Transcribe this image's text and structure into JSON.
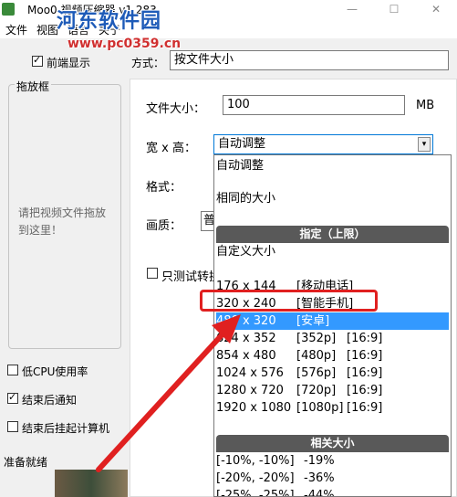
{
  "window": {
    "title": "Moo0 视频压缩器 v1.283",
    "minimize": "—",
    "maximize": "☐",
    "close": "✕"
  },
  "watermark": {
    "line1": "河东软件园",
    "line2": "www.pc0359.cn"
  },
  "menu": [
    "文件",
    "视图",
    "语言",
    "关于"
  ],
  "left": {
    "always_on_top": {
      "label": "前端显示",
      "checked": true
    },
    "drop_box_title": "拖放框",
    "drop_hint": "请把视频文件拖放到这里！",
    "low_cpu": {
      "label": "低CPU使用率",
      "checked": false
    },
    "notify_done": {
      "label": "结束后通知",
      "checked": true
    },
    "shutdown_done": {
      "label": "结束后挂起计算机",
      "checked": false
    },
    "status": "准备就绪"
  },
  "right": {
    "mode_label": "方式：",
    "mode_value": "按文件大小",
    "filesize_label": "文件大小：",
    "filesize_value": "100",
    "filesize_unit": "MB",
    "dims_label": "宽 x 高：",
    "dims_value": "自动调整",
    "format_label": "格式：",
    "quality_label": "画质：",
    "quality_value_partial": "普",
    "test_only_label": "只测试转换",
    "test_only_checked": false
  },
  "dropdown": {
    "top_options": [
      "自动调整",
      "相同的大小"
    ],
    "group_specified": "指定（上限）",
    "custom": "自定义大小",
    "sizes": [
      {
        "res": "176 x 144",
        "tag": "[移动电话]",
        "ratio": ""
      },
      {
        "res": "320 x 240",
        "tag": "[智能手机]",
        "ratio": ""
      },
      {
        "res": "480 x 320",
        "tag": "[安卓]",
        "ratio": ""
      },
      {
        "res": "624 x 352",
        "tag": "[352p]",
        "ratio": "[16:9]"
      },
      {
        "res": "854 x 480",
        "tag": "[480p]",
        "ratio": "[16:9]"
      },
      {
        "res": "1024 x 576",
        "tag": "[576p]",
        "ratio": "[16:9]"
      },
      {
        "res": "1280 x 720",
        "tag": "[720p]",
        "ratio": "[16:9]"
      },
      {
        "res": "1920 x 1080",
        "tag": "[1080p]",
        "ratio": "[16:9]"
      }
    ],
    "selected_index": 2,
    "group_relative": "相关大小",
    "relative": [
      {
        "range": "[-10%, -10%]",
        "pct": "-19%"
      },
      {
        "range": "[-20%, -20%]",
        "pct": "-36%"
      },
      {
        "range": "[-25%, -25%]",
        "pct": "-44%"
      }
    ]
  },
  "colors": {
    "accent": "#3399ff",
    "highlight_box": "#e02020",
    "group_header": "#595959"
  }
}
